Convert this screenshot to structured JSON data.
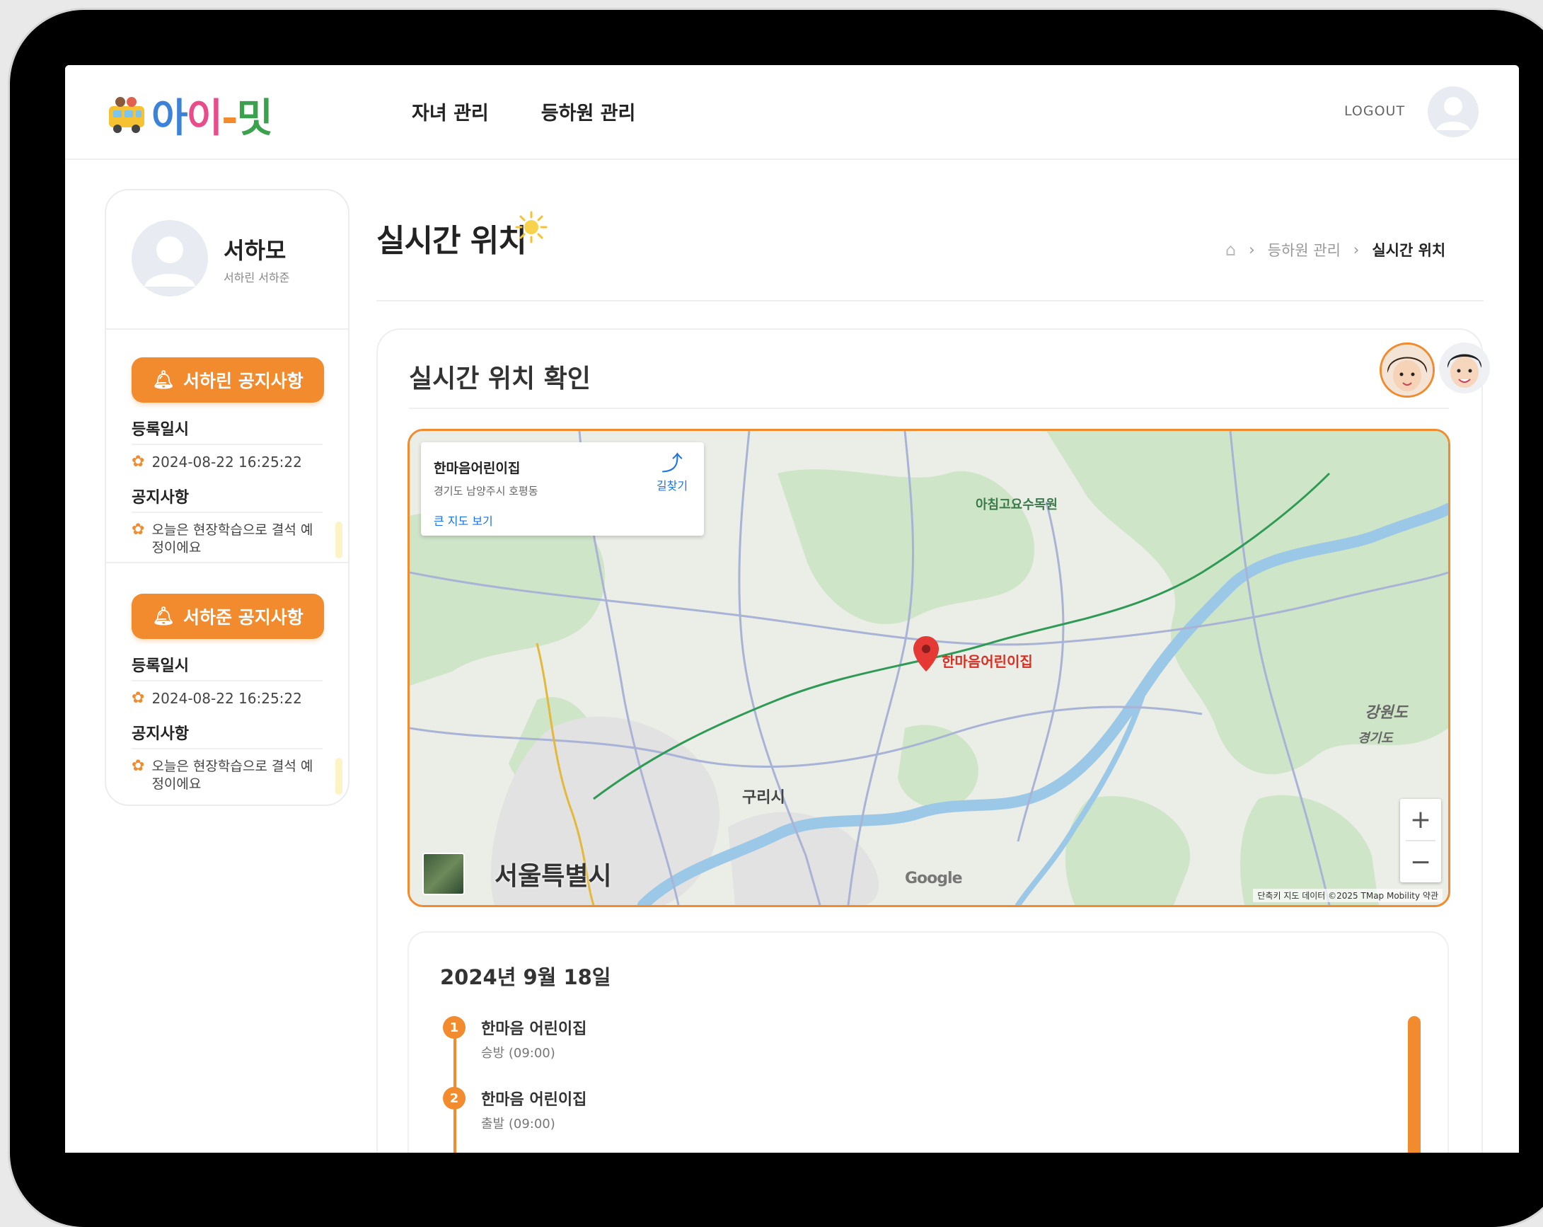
{
  "header": {
    "logo_text": "아이-밋",
    "nav": [
      "자녀 관리",
      "등하원 관리"
    ],
    "logout": "LOGOUT"
  },
  "sidebar": {
    "profile_name": "서하모",
    "profile_sub": "서하린 서하준",
    "notices": [
      {
        "button": "서하린 공지사항",
        "date_label": "등록일시",
        "date": "2024-08-22 16:25:22",
        "notice_label": "공지사항",
        "text": "오늘은 현장학습으로 결석 예정이에요"
      },
      {
        "button": "서하준 공지사항",
        "date_label": "등록일시",
        "date": "2024-08-22 16:25:22",
        "notice_label": "공지사항",
        "text": "오늘은 현장학습으로 결석 예정이에요"
      }
    ]
  },
  "page": {
    "title": "실시간 위치",
    "breadcrumb": [
      "등하원 관리",
      "실시간 위치"
    ]
  },
  "card": {
    "title": "실시간 위치 확인"
  },
  "map": {
    "info_title": "한마음어린이집",
    "info_address": "경기도 남양주시 호평동",
    "info_link": "큰 지도 보기",
    "directions": "길찾기",
    "marker_label": "한마음어린이집",
    "city_label": "서울특별시",
    "labels": [
      "구리시",
      "강원도",
      "경기도",
      "아침고요수목원"
    ],
    "google": "Google",
    "footer": "단축키  지도 데이터 ©2025 TMap Mobility  약관",
    "zoom_in": "+",
    "zoom_out": "−"
  },
  "timeline": {
    "date": "2024년 9월 18일",
    "items": [
      {
        "num": "1",
        "name": "한마음 어린이집",
        "sub": "승방 (09:00)"
      },
      {
        "num": "2",
        "name": "한마음 어린이집",
        "sub": "출발 (09:00)"
      }
    ]
  },
  "colors": {
    "accent": "#f28a2e",
    "map_border": "#f28a2e"
  }
}
